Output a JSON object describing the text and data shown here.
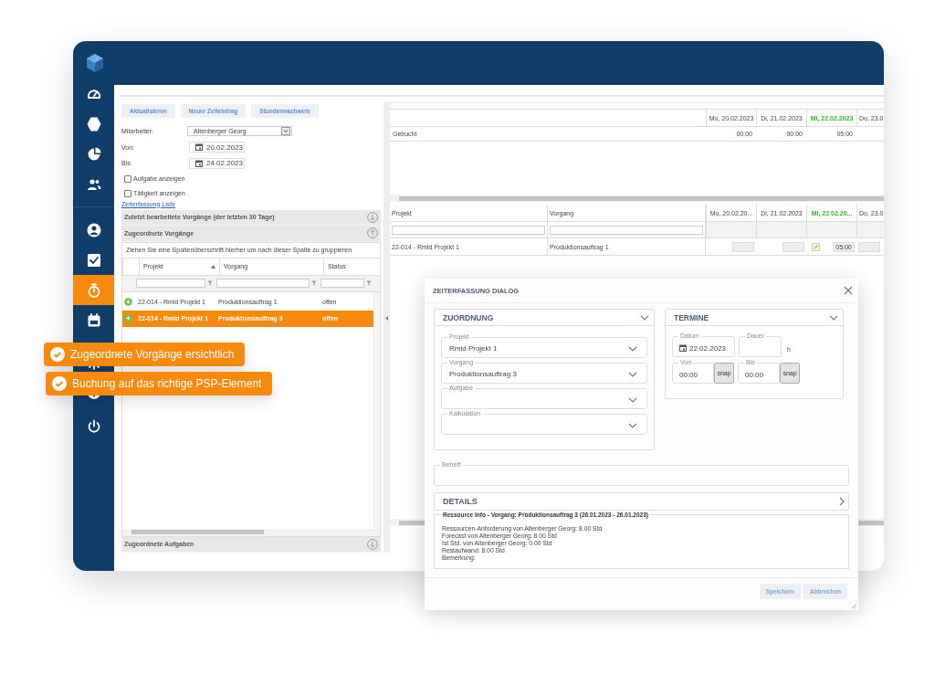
{
  "sidebar": {
    "groups": [
      [
        {
          "kind": "gauge",
          "selected": false
        },
        {
          "kind": "hexagon",
          "selected": false
        },
        {
          "kind": "pie",
          "selected": false
        },
        {
          "kind": "users",
          "selected": false
        }
      ],
      [
        {
          "kind": "user",
          "selected": false
        },
        {
          "kind": "check",
          "selected": false
        },
        {
          "kind": "timer",
          "selected": true
        },
        {
          "kind": "calendar",
          "selected": false
        },
        {
          "kind": "gear",
          "selected": false
        },
        {
          "kind": "info",
          "selected": false
        },
        {
          "kind": "power",
          "selected": false
        }
      ]
    ]
  },
  "toolbar": {
    "buttons": [
      "Aktualisieren",
      "Neuer Zeiteintrag",
      "Stundennachweis"
    ]
  },
  "filters": {
    "employee": {
      "label": "Mitarbeiter:",
      "value": "Altenberger Georg"
    },
    "from": {
      "label": "Von:",
      "value": "20.02.2023"
    },
    "to": {
      "label": "Bis:",
      "value": "24.02.2023"
    },
    "checkboxes": [
      {
        "label": "Aufgabe anzeigen",
        "checked": false
      },
      {
        "label": "Tätigkeit anzeigen",
        "checked": false
      }
    ],
    "link": "Zeiterfassung Liste"
  },
  "recent_section": {
    "title": "Zuletzt bearbeitete Vorgänge (der letzten 30 Tage)",
    "expanded": false
  },
  "assigned_section": {
    "title": "Zugeordnete Vorgänge",
    "expanded": true,
    "group_hint": "Ziehen Sie eine Spaltenüberschrift hierher um nach dieser Spalte zu gruppieren",
    "columns": [
      {
        "label": "Projekt",
        "sorted": true
      },
      {
        "label": "Vorgang",
        "sorted": false
      },
      {
        "label": "Status",
        "sorted": false
      }
    ],
    "rows": [
      {
        "project": "22-014 - Rmld Projekt 1",
        "task": "Produktionsauftrag 1",
        "status": "offen",
        "selected": false
      },
      {
        "project": "22-014 - Rmld Projekt 1",
        "task": "Produktionsauftrag 3",
        "status": "offen",
        "selected": true
      }
    ]
  },
  "tasks_section": {
    "title": "Zugeordnete Aufgaben",
    "expanded": false
  },
  "summary_grid": {
    "days": [
      {
        "label": "Mo, 20.02.2023",
        "today": false
      },
      {
        "label": "Di, 21.02.2023",
        "today": false
      },
      {
        "label": "Mi, 22.02.2023",
        "today": true
      },
      {
        "label": "Do, 23.0",
        "today": false
      }
    ],
    "rows": [
      {
        "label": "Gebucht",
        "values": [
          "00:00",
          "00:00",
          "05:00"
        ]
      }
    ]
  },
  "booking_grid": {
    "columns": [
      "Projekt",
      "Vorgang"
    ],
    "days": [
      {
        "label": "Mo, 20.02.20...",
        "today": false
      },
      {
        "label": "Di, 21.02.2023",
        "today": false
      },
      {
        "label": "Mi, 22.02.20...",
        "today": true
      },
      {
        "label": "Do, 23.0",
        "today": false
      }
    ],
    "rows": [
      {
        "project": "22-014 - Rmld Projekt 1",
        "task": "Produktionsauftrag 1",
        "cells": [
          {
            "kind": "empty"
          },
          {
            "kind": "empty"
          },
          {
            "kind": "edit",
            "value": "05:00"
          },
          {
            "kind": "empty"
          }
        ]
      }
    ]
  },
  "dialog": {
    "title": "ZEITERFASSUNG DIALOG",
    "assignment": {
      "title": "ZUORDNUNG",
      "expanded": true,
      "fields": [
        {
          "label": "Projekt",
          "value": "Rmld Projekt 1"
        },
        {
          "label": "Vorgang",
          "value": "Produktionsauftrag 3"
        },
        {
          "label": "Aufgabe"
        },
        {
          "label": "Kalkulation"
        }
      ]
    },
    "schedule": {
      "title": "TERMINE",
      "expanded": true,
      "date": {
        "label": "Datum",
        "value": "22.02.2023"
      },
      "duration": {
        "label": "Dauer",
        "unit": "h"
      },
      "times": [
        {
          "label": "Von",
          "value": "00:00",
          "button": "snap"
        },
        {
          "label": "Bis",
          "value": "00:00",
          "button": "snap"
        }
      ]
    },
    "subject": {
      "label": "Betreff"
    },
    "details": {
      "title": "DETAILS",
      "expanded": false,
      "legend": "Ressource Info - Vorgang: Produktionsauftrag 3 (26.01.2023 - 26.01.2023)",
      "lines": [
        "Ressourcen-Anforderung von Altenberger Georg: 8.00 Std",
        "Forecast von Altenberger Georg: 8.00 Std",
        "Ist Std. von Altenberger Georg: 0.00 Std",
        "Restaufwand: 8.00 Std",
        "Bemerkung:"
      ]
    },
    "buttons": [
      "Speichern",
      "Abbrechen"
    ]
  },
  "callouts": [
    "Zugeordnete Vorgänge ersichtlich",
    "Buchung auf das richtige PSP-Element"
  ]
}
